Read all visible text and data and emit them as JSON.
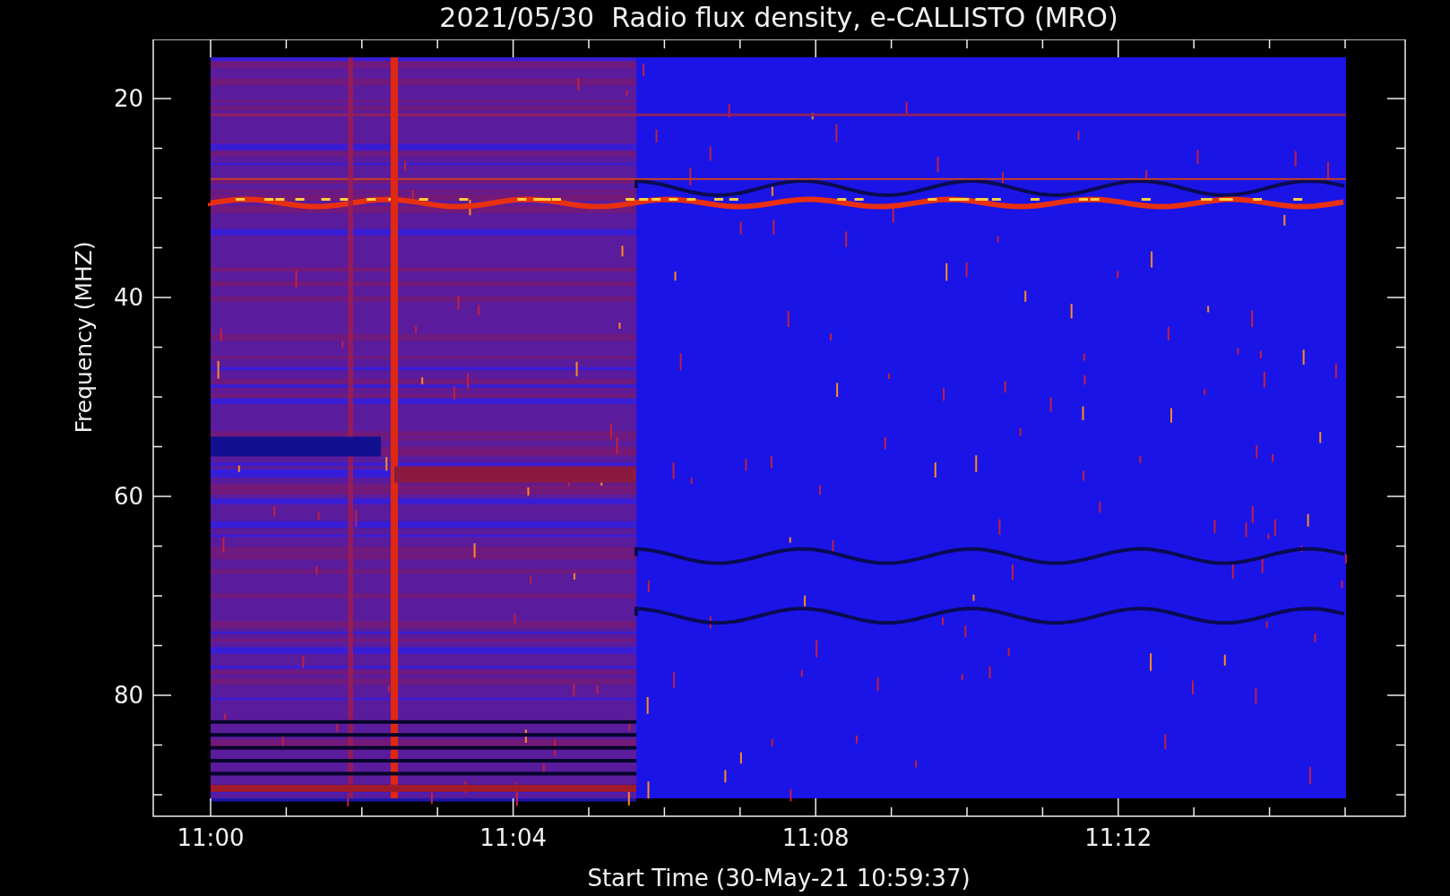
{
  "title": "2021/05/30  Radio flux density, e-CALLISTO (MRO)",
  "y_axis": {
    "label": "Frequency (MHZ)",
    "ticks": [
      "20",
      "40",
      "60",
      "80"
    ]
  },
  "x_axis": {
    "label": "Start Time (30-May-21 10:59:37)",
    "ticks": [
      "11:00",
      "11:04",
      "11:08",
      "11:12"
    ]
  }
}
